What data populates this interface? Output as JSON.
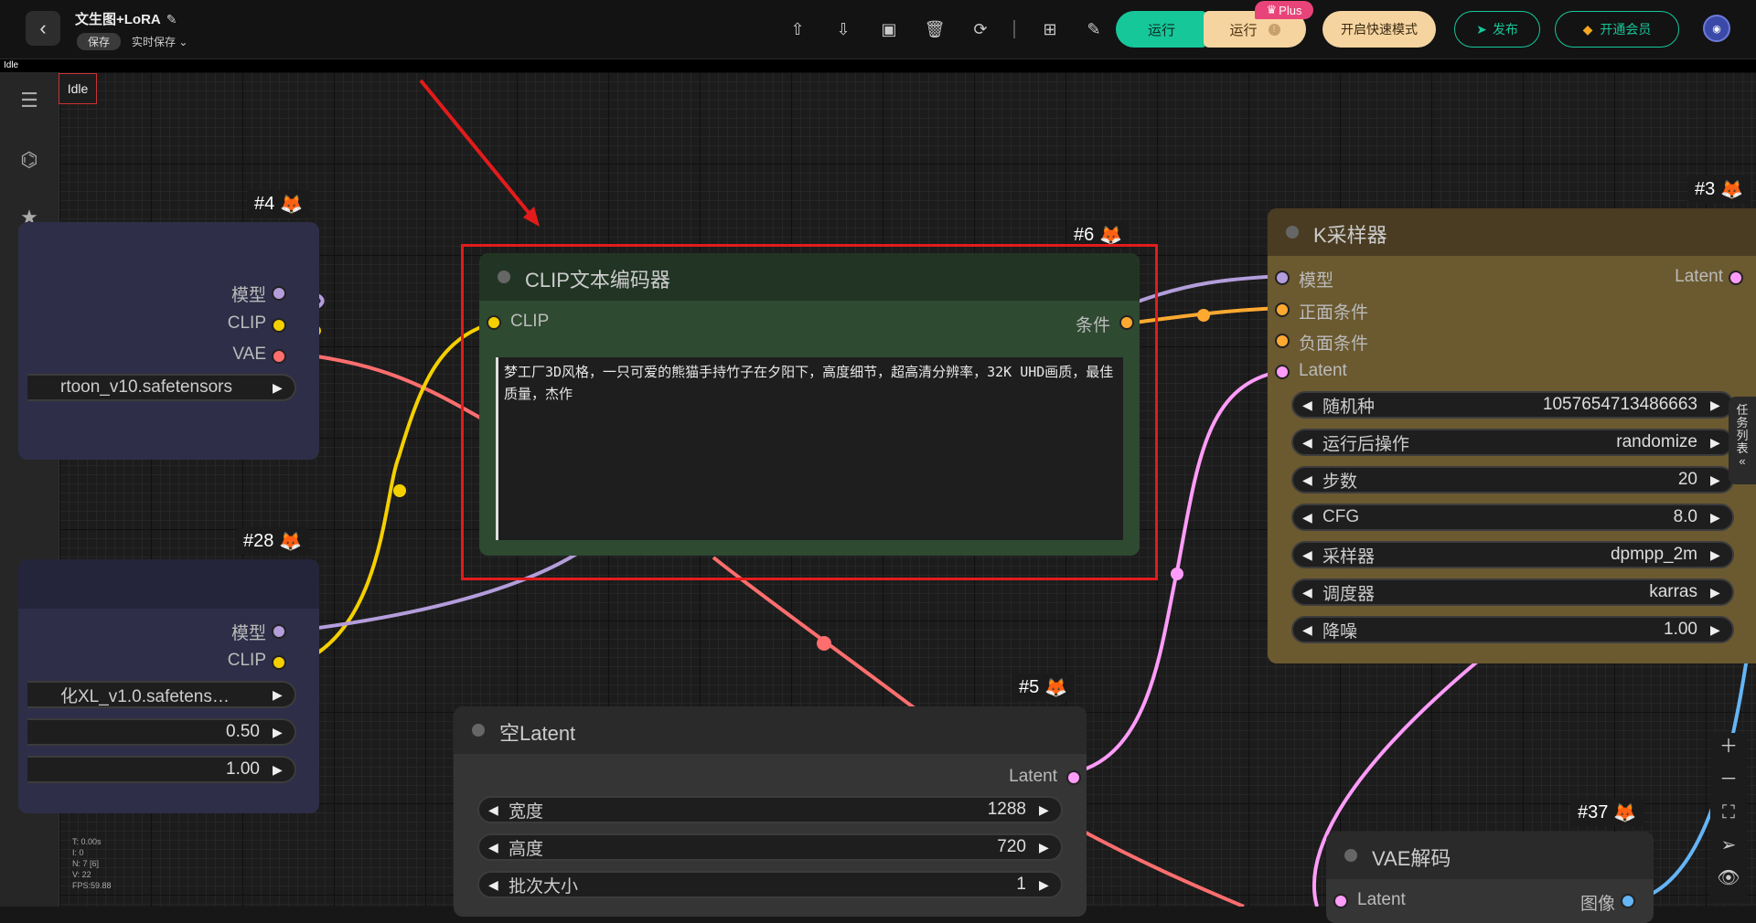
{
  "header": {
    "back_label": "‹",
    "title": "文生图+LoRA",
    "save_label": "保存",
    "autosave_label": "实时保存",
    "run_label": "运行",
    "run_plus_label": "运行",
    "plus_badge": "Plus",
    "fast_mode_label": "开启快速模式",
    "publish_label": "发布",
    "member_label": "开通会员"
  },
  "status": {
    "top_label": "Idle",
    "canvas_label": "Idle"
  },
  "nodes": {
    "n4": {
      "tag": "#4",
      "outputs": [
        "模型",
        "CLIP",
        "VAE"
      ],
      "ckpt": "rtoon_v10.safetensors"
    },
    "n28": {
      "tag": "#28",
      "outputs": [
        "模型",
        "CLIP"
      ],
      "lora": "化XL_v1.0.safetens…",
      "strength_model": "0.50",
      "strength_clip": "1.00"
    },
    "n6": {
      "tag": "#6",
      "title": "CLIP文本编码器",
      "input": "CLIP",
      "output": "条件",
      "text": "梦工厂3D风格，一只可爱的熊猫手持竹子在夕阳下，高度细节，超高清分辨率，32K UHD画质，最佳质量，杰作"
    },
    "n3": {
      "tag": "#3",
      "title": "K采样器",
      "inputs": [
        "模型",
        "正面条件",
        "负面条件",
        "Latent"
      ],
      "output": "Latent",
      "widgets": [
        {
          "label": "随机种",
          "value": "1057654713486663"
        },
        {
          "label": "运行后操作",
          "value": "randomize"
        },
        {
          "label": "步数",
          "value": "20"
        },
        {
          "label": "CFG",
          "value": "8.0"
        },
        {
          "label": "采样器",
          "value": "dpmpp_2m"
        },
        {
          "label": "调度器",
          "value": "karras"
        },
        {
          "label": "降噪",
          "value": "1.00"
        }
      ]
    },
    "n5": {
      "tag": "#5",
      "title": "空Latent",
      "output": "Latent",
      "widgets": [
        {
          "label": "宽度",
          "value": "1288"
        },
        {
          "label": "高度",
          "value": "720"
        },
        {
          "label": "批次大小",
          "value": "1"
        }
      ]
    },
    "n37": {
      "tag": "#37",
      "title": "VAE解码",
      "input": "Latent",
      "output": "图像"
    }
  },
  "task_list_label": "任务列表",
  "stats": [
    "T: 0.00s",
    "I: 0",
    "N: 7 [6]",
    "V: 22",
    "FPS:59.88"
  ],
  "colors": {
    "accent": "#16c79a",
    "highlight_red": "#e31b1b",
    "clip_yellow": "#f5d000",
    "model_purple": "#b39ddb",
    "vae_red": "#ff6e6e",
    "latent_pink": "#ff9cf9",
    "cond_orange": "#ffa931"
  }
}
